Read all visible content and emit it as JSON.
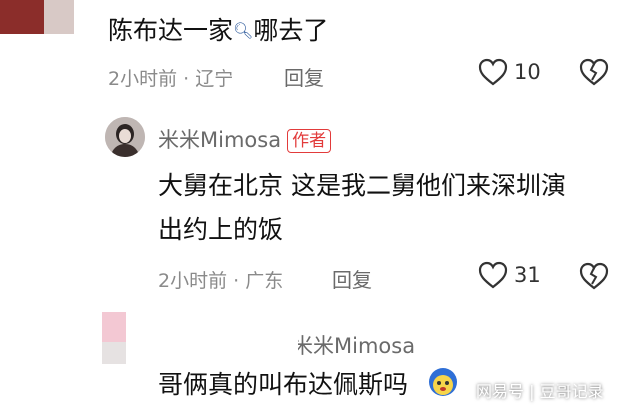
{
  "comment1": {
    "text_main": "陈布达一家",
    "text_tail": "哪去了",
    "time": "2小时前",
    "location": "· 辽宁",
    "reply_label": "回复",
    "likes": "10"
  },
  "reply1": {
    "username": "米米Mimosa",
    "author_tag": "作者",
    "line1": "大舅在北京 这是我二舅他们来深圳演",
    "line2": "出约上的饭",
    "time": "2小时前",
    "location": "· 广东",
    "reply_label": "回复",
    "likes": "31"
  },
  "reply2": {
    "username": "米米Mimosa",
    "text": "哥俩真的叫布达佩斯吗"
  },
  "watermark": {
    "brand": "网易号",
    "divider": "|",
    "account": "豆哥记录"
  }
}
